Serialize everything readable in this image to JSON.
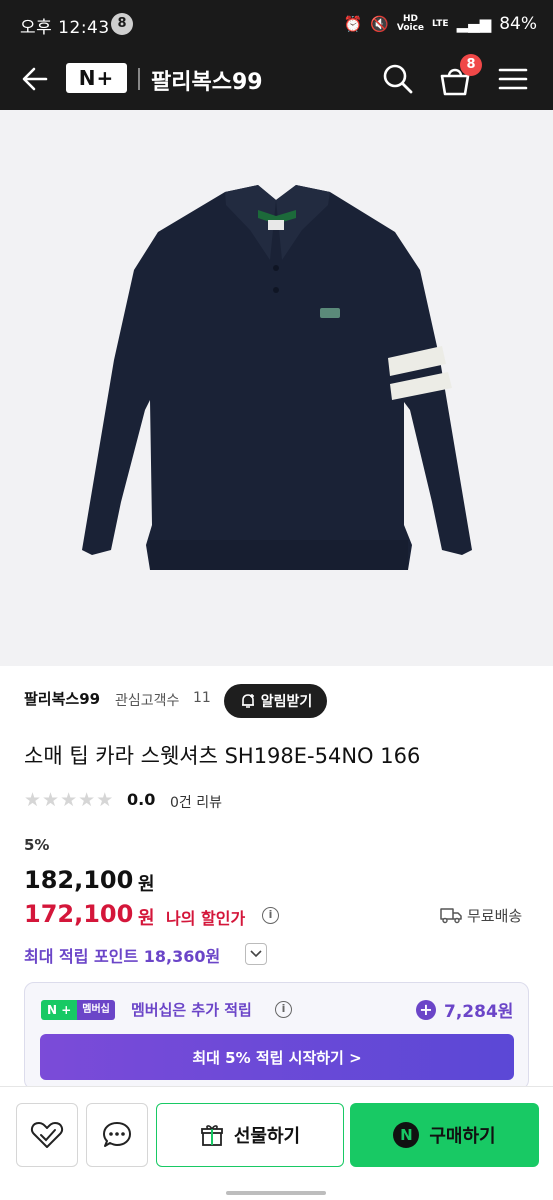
{
  "status_bar": {
    "time": "오후 12:43",
    "notification_count": "8",
    "hd": "HD",
    "voice": "Voice",
    "network": "LTE",
    "battery": "84%"
  },
  "header": {
    "brand_badge": "N+",
    "store_name": "팔리복스99",
    "cart_count": "8"
  },
  "seller": {
    "name": "팔리복스99",
    "interest_label": "관심고객수",
    "interest_count": "11",
    "alarm_label": "알림받기"
  },
  "product": {
    "title": "소매 팁 카라 스웻셔츠 SH198E-54NO 166",
    "rating": "0.0",
    "rating_fraction": 0,
    "reviews": "0건 리뷰",
    "discount_rate": "5%",
    "original_price": "182,100",
    "sale_price": "172,100",
    "currency": "원",
    "my_discount_label": "나의 할인가",
    "shipping": "무료배송",
    "max_points": "최대 적립 포인트 18,360원"
  },
  "membership": {
    "badge_np": "N +",
    "badge_label": "멤버십",
    "text": "멤버십은 추가 적립",
    "points": "7,284원",
    "cta": "최대 5% 적립 시작하기 >"
  },
  "bottom_bar": {
    "gift_label": "선물하기",
    "buy_label": "구매하기",
    "buy_icon": "N"
  },
  "colors": {
    "accent_green": "#18c964",
    "accent_purple": "#6b45c8",
    "sale_red": "#d4163a"
  }
}
